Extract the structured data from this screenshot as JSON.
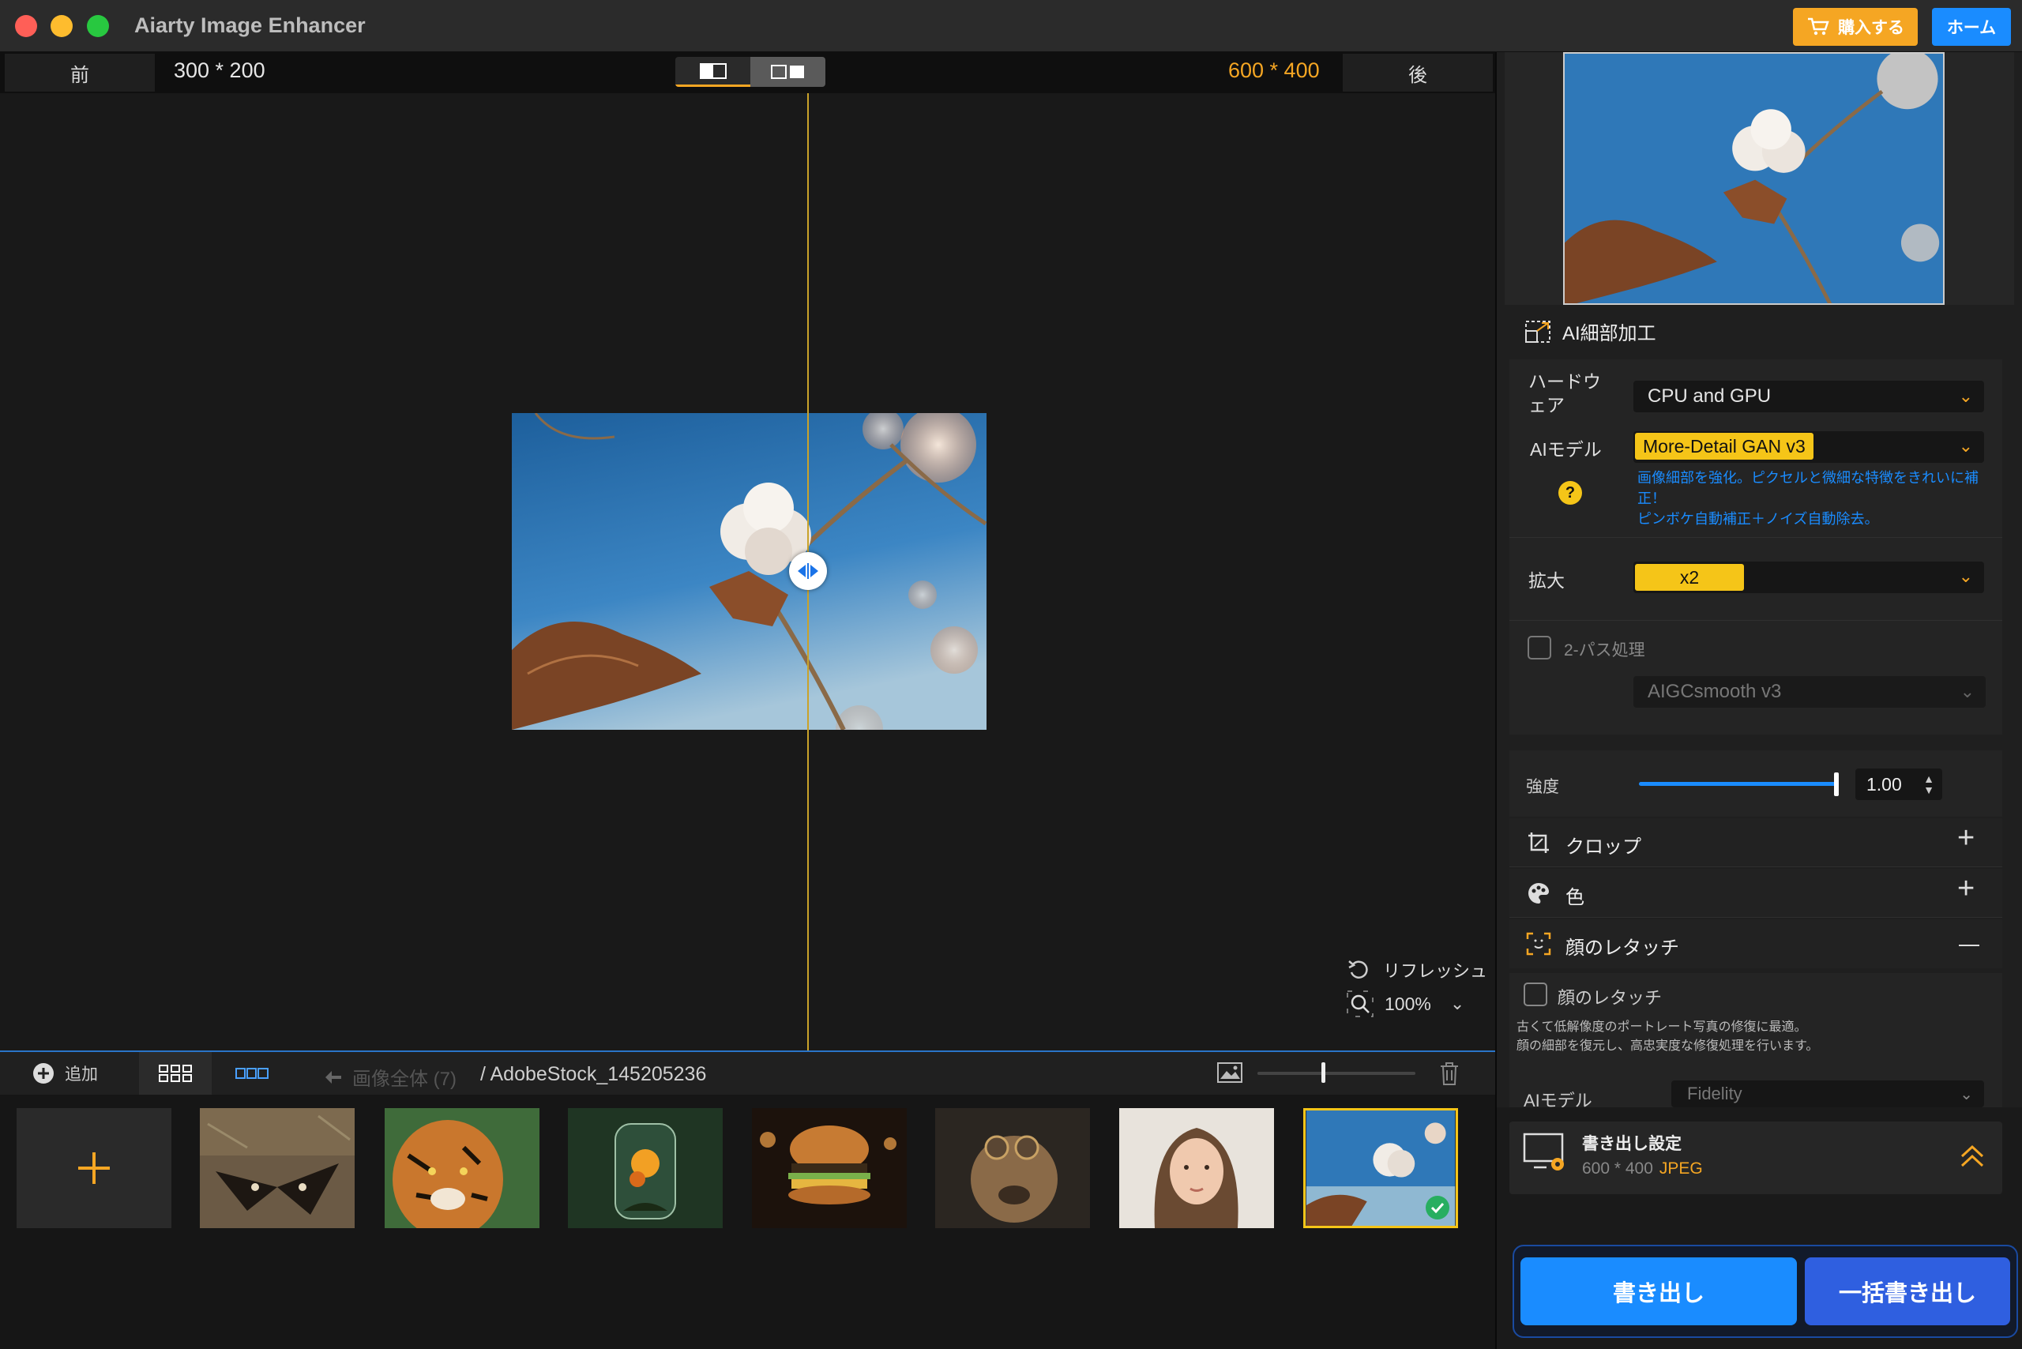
{
  "window": {
    "title": "Aiarty Image Enhancer"
  },
  "header": {
    "buy_label": "購入する",
    "home_label": "ホーム"
  },
  "compare": {
    "before_label": "前",
    "after_label": "後",
    "before_dim": "300 * 200",
    "after_dim": "600 * 400"
  },
  "canvas": {
    "refresh_label": "リフレッシュ",
    "zoom": "100%"
  },
  "filmbar": {
    "add_label": "追加",
    "all_images": "画像全体 (7)",
    "path": "/ AdobeStock_145205236"
  },
  "thumbnails": [
    {
      "name": "butterfly"
    },
    {
      "name": "tiger"
    },
    {
      "name": "terrarium"
    },
    {
      "name": "burger"
    },
    {
      "name": "dog-steampunk"
    },
    {
      "name": "portrait-woman"
    },
    {
      "name": "cotton-flower",
      "selected": true
    }
  ],
  "panel": {
    "ai_detail_title": "AI細部加工",
    "hardware_label": "ハードウェア",
    "hardware_value": "CPU and GPU",
    "model_label": "AIモデル",
    "model_value": "More-Detail GAN  v3",
    "model_desc_1": "画像細部を強化。ピクセルと微細な特徴をきれいに補正！",
    "model_desc_2": "ピンボケ自動補正＋ノイズ自動除去。",
    "scale_label": "拡大",
    "scale_value": "x2",
    "twopass_label": "2-パス処理",
    "twopass_model": "AIGCsmooth  v3",
    "strength_label": "強度",
    "strength_value": "1.00",
    "strength_fraction": 1.0,
    "crop_label": "クロップ",
    "color_label": "色",
    "face_label": "顔のレタッチ",
    "face_check_label": "顔のレタッチ",
    "face_desc_1": "古くて低解像度のポートレート写真の修復に最適。",
    "face_desc_2": "顔の細部を復元し、高忠実度な修復処理を行います。",
    "face_model_label": "AIモデル",
    "face_model_value": "Fidelity"
  },
  "export": {
    "settings_title": "書き出し設定",
    "settings_dim": "600 * 400",
    "settings_format": "JPEG",
    "export_label": "書き出し",
    "batch_label": "一括書き出し"
  },
  "colors": {
    "accent": "#f5a623",
    "blue": "#1a8cff",
    "batch": "#2f5fe0"
  }
}
